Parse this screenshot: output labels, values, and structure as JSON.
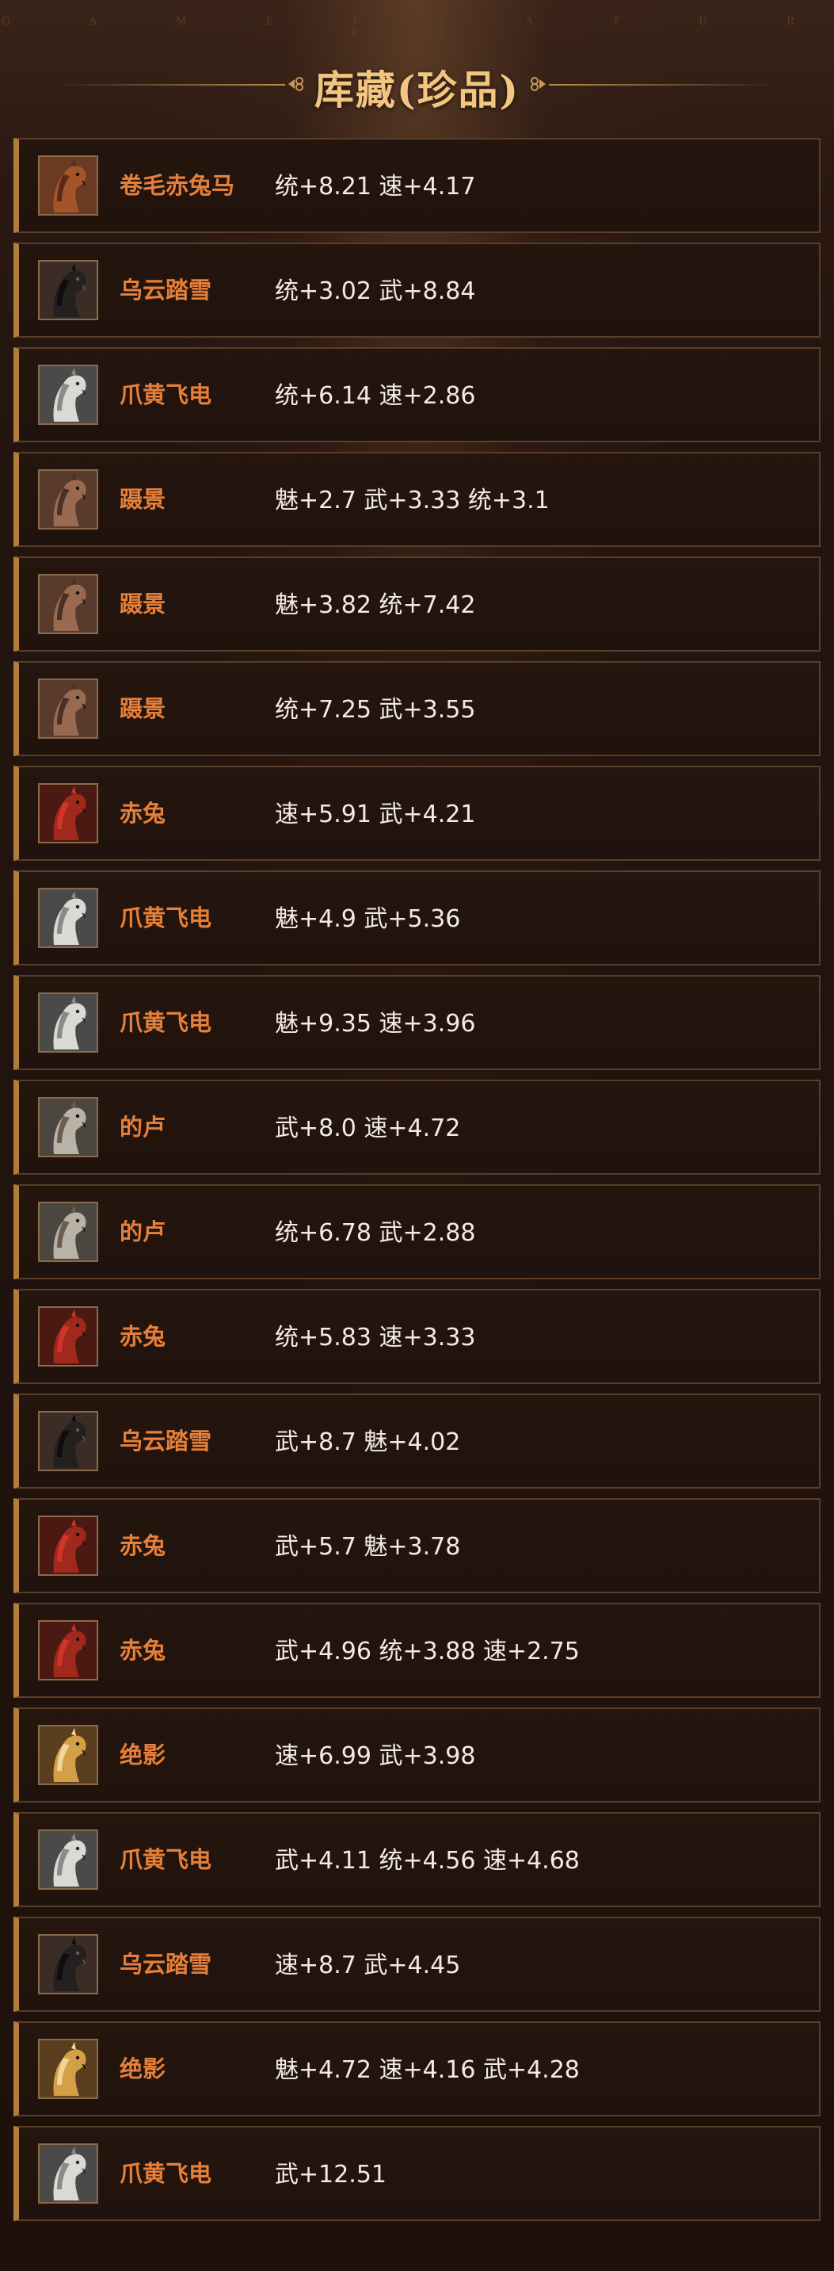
{
  "header": {
    "subtitle": "G A M E   F E A T U R E S",
    "title": "库藏(珍品)"
  },
  "colors": {
    "accent_gold": "#f2c680",
    "name_orange": "#e57f3a",
    "card_border": "#5b3d28",
    "card_left_bar": "#b27c3c"
  },
  "items": [
    {
      "name": "卷毛赤兔马",
      "stats": "统+8.21 速+4.17",
      "icon": "horse-brown-icon"
    },
    {
      "name": "乌云踏雪",
      "stats": "统+3.02 武+8.84",
      "icon": "horse-black-icon"
    },
    {
      "name": "爪黄飞电",
      "stats": "统+6.14 速+2.86",
      "icon": "horse-white-armored-icon"
    },
    {
      "name": "蹑景",
      "stats": "魅+2.7 武+3.33 统+3.1",
      "icon": "horse-roan-icon"
    },
    {
      "name": "蹑景",
      "stats": "魅+3.82 统+7.42",
      "icon": "horse-roan-icon"
    },
    {
      "name": "蹑景",
      "stats": "统+7.25 武+3.55",
      "icon": "horse-roan-icon"
    },
    {
      "name": "赤兔",
      "stats": "速+5.91 武+4.21",
      "icon": "horse-red-icon"
    },
    {
      "name": "爪黄飞电",
      "stats": "魅+4.9 武+5.36",
      "icon": "horse-white-armored-icon"
    },
    {
      "name": "爪黄飞电",
      "stats": "魅+9.35 速+3.96",
      "icon": "horse-white-armored-icon"
    },
    {
      "name": "的卢",
      "stats": "武+8.0 速+4.72",
      "icon": "horse-grey-icon"
    },
    {
      "name": "的卢",
      "stats": "统+6.78 武+2.88",
      "icon": "horse-grey-icon"
    },
    {
      "name": "赤兔",
      "stats": "统+5.83 速+3.33",
      "icon": "horse-red-icon"
    },
    {
      "name": "乌云踏雪",
      "stats": "武+8.7 魅+4.02",
      "icon": "horse-black-icon"
    },
    {
      "name": "赤兔",
      "stats": "武+5.7 魅+3.78",
      "icon": "horse-red-icon"
    },
    {
      "name": "赤兔",
      "stats": "武+4.96 统+3.88 速+2.75",
      "icon": "horse-red-icon"
    },
    {
      "name": "绝影",
      "stats": "速+6.99 武+3.98",
      "icon": "horse-golden-icon"
    },
    {
      "name": "爪黄飞电",
      "stats": "武+4.11 统+4.56 速+4.68",
      "icon": "horse-white-armored-icon"
    },
    {
      "name": "乌云踏雪",
      "stats": "速+8.7 武+4.45",
      "icon": "horse-black-icon"
    },
    {
      "name": "绝影",
      "stats": "魅+4.72 速+4.16 武+4.28",
      "icon": "horse-golden-icon"
    },
    {
      "name": "爪黄飞电",
      "stats": "武+12.51",
      "icon": "horse-white-armored-icon"
    }
  ]
}
